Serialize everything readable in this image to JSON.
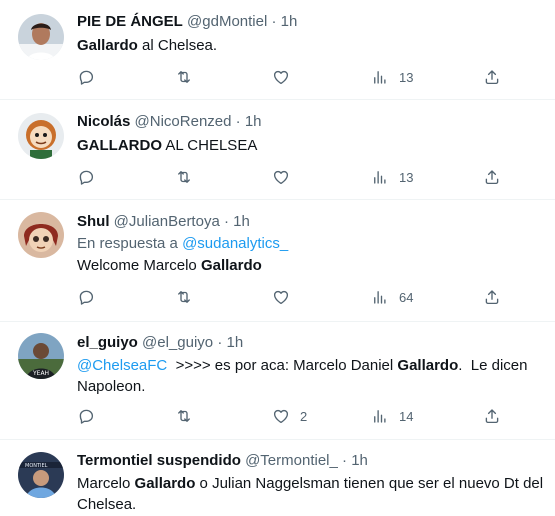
{
  "tweets": [
    {
      "name": "PIE DE ÁNGEL",
      "handle": "@gdMontiel",
      "sep": "·",
      "time": "1h",
      "text": "Gallardo al Chelsea.",
      "bold": "Gallardo",
      "rest": " al Chelsea.",
      "likes": "",
      "views": "13"
    },
    {
      "name": "Nicolás",
      "handle": "@NicoRenzed",
      "sep": "·",
      "time": "1h",
      "bold": "GALLARDO",
      "rest": " AL CHELSEA",
      "likes": "",
      "views": "13"
    },
    {
      "name": "Shul",
      "handle": "@JulianBertoya",
      "sep": "·",
      "time": "1h",
      "reply_prefix": "En respuesta a ",
      "reply_to": "@sudanalytics_",
      "pre": "Welcome Marcelo ",
      "bold": "Gallardo",
      "likes": "",
      "views": "64"
    },
    {
      "name": "el_guiyo",
      "handle": "@el_guiyo",
      "sep": "·",
      "time": "1h",
      "mention": "@ChelseaFC",
      "pre": "  >>>> es por aca: Marcelo Daniel ",
      "bold": "Gallardo",
      "rest": ".  Le dicen",
      "line2": "Napoleon.",
      "likes": "2",
      "views": "14"
    },
    {
      "name": "Termontiel suspendido",
      "handle": "@Termontiel_",
      "sep": "·",
      "time": "1h",
      "pre": "Marcelo ",
      "bold": "Gallardo",
      "rest": " o Julian Naggelsman tienen que ser el nuevo Dt del",
      "line2": "Chelsea."
    }
  ],
  "colors": {
    "text": "#0f1419",
    "muted": "#536471",
    "link": "#1d9bf0",
    "divider": "#eff3f4"
  },
  "icons": [
    "reply-icon",
    "retweet-icon",
    "like-icon",
    "views-icon",
    "share-icon"
  ]
}
